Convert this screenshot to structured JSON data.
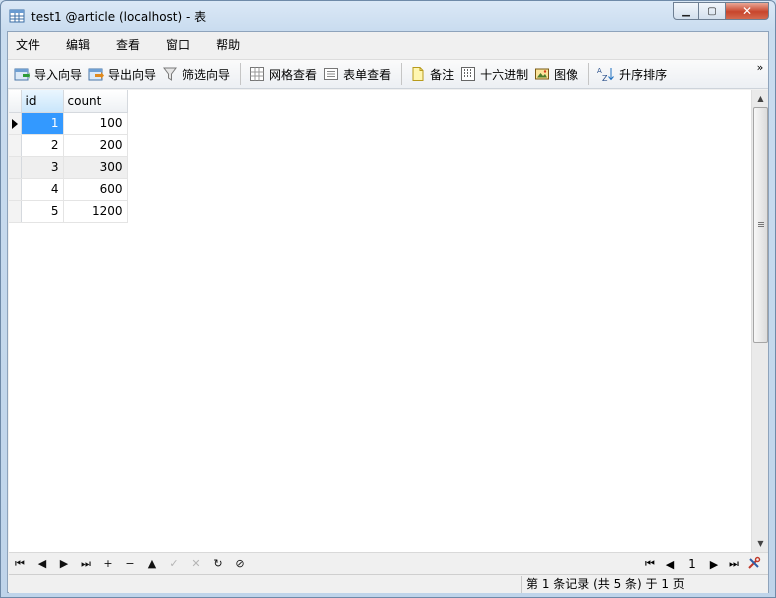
{
  "window": {
    "title": "test1 @article (localhost) - 表",
    "min_glyph": "▁",
    "max_glyph": "▢",
    "close_glyph": "✕"
  },
  "menu": [
    "文件",
    "编辑",
    "查看",
    "窗口",
    "帮助"
  ],
  "toolbar": {
    "import_wizard": "导入向导",
    "export_wizard": "导出向导",
    "filter_wizard": "筛选向导",
    "grid_view": "网格查看",
    "form_view": "表单查看",
    "memo": "备注",
    "hex": "十六进制",
    "image": "图像",
    "sort_asc": "升序排序",
    "more": "»"
  },
  "table": {
    "columns": [
      "id",
      "count"
    ],
    "rows": [
      {
        "id": "1",
        "count": "100"
      },
      {
        "id": "2",
        "count": "200"
      },
      {
        "id": "3",
        "count": "300"
      },
      {
        "id": "4",
        "count": "600"
      },
      {
        "id": "5",
        "count": "1200"
      }
    ]
  },
  "navbar": {
    "first": "⏮",
    "prev": "◀",
    "next": "▶",
    "last": "⏭",
    "add": "+",
    "delete": "−",
    "up": "▲",
    "apply": "✓",
    "cancel": "✕",
    "refresh": "↻",
    "stop": "⊘"
  },
  "pager": {
    "page": "1"
  },
  "status": {
    "record_text": "第 1 条记录 (共 5 条) 于 1 页"
  },
  "colors": {
    "selection": "#3399ff",
    "header_selected": "#c9e6fb"
  }
}
